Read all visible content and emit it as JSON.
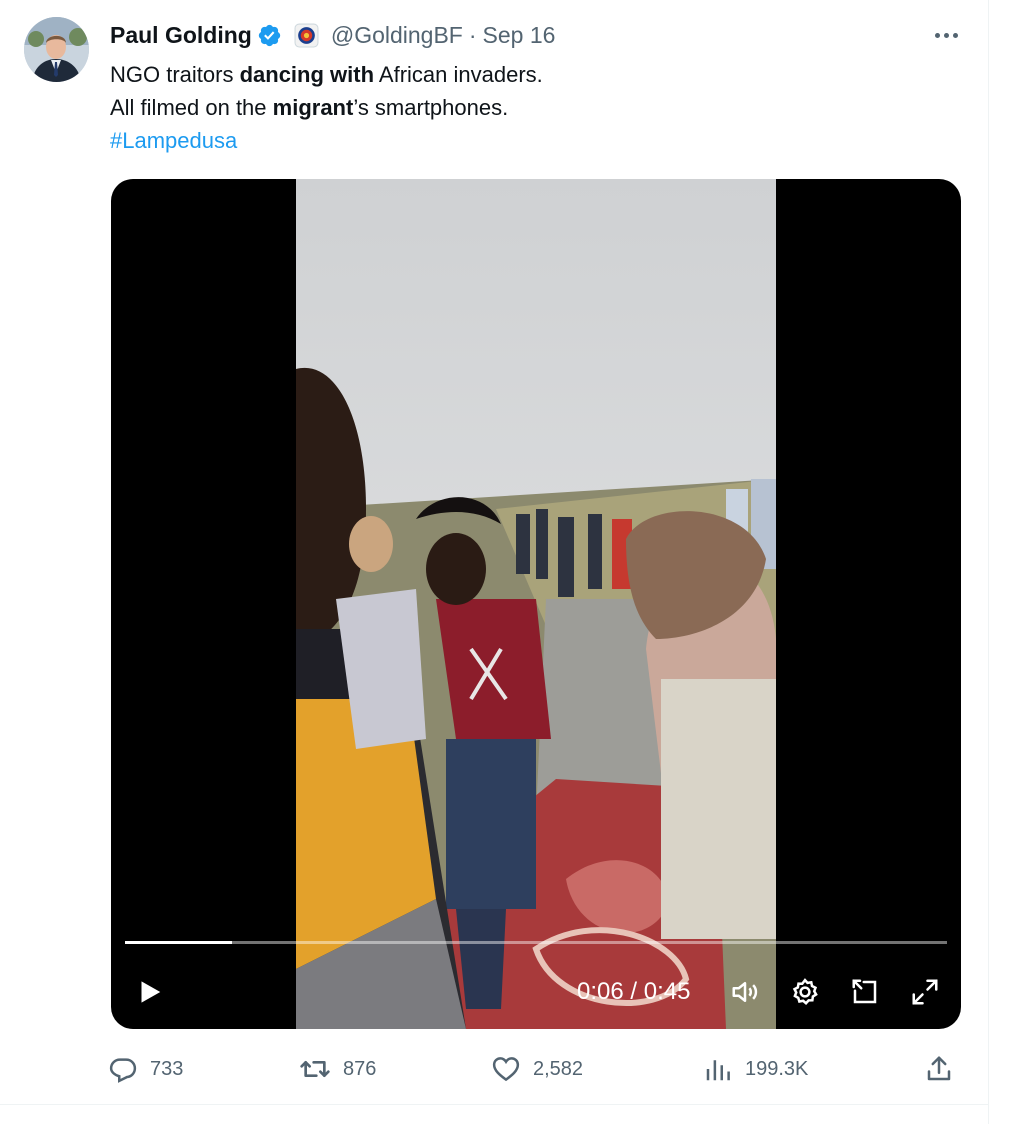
{
  "tweet": {
    "author_name": "Paul Golding",
    "handle": "@GoldingBF",
    "separator": "·",
    "date": "Sep 16",
    "line1_part1": "NGO traitors ",
    "line1_bold": "dancing with",
    "line1_part2": " African invaders.",
    "line2_part1": "All filmed on the ",
    "line2_bold": "migrant",
    "line2_part2": "’s smartphones.",
    "hashtag": "#Lampedusa"
  },
  "video": {
    "current_time": "0:06",
    "time_separator": " / ",
    "duration": "0:45",
    "progress_fraction": 0.13
  },
  "actions": {
    "replies": "733",
    "reposts": "876",
    "likes": "2,582",
    "views": "199.3K"
  },
  "icons": {
    "verified": "verified-badge-icon",
    "affiliate": "affiliate-flag-icon",
    "more": "more-options-icon",
    "play": "play-icon",
    "volume": "volume-icon",
    "settings": "gear-icon",
    "pip": "picture-in-picture-icon",
    "fullscreen": "fullscreen-icon",
    "reply": "reply-icon",
    "repost": "repost-icon",
    "like": "heart-icon",
    "views": "views-chart-icon",
    "share": "share-icon"
  },
  "colors": {
    "text": "#0f1419",
    "secondary": "#536471",
    "link": "#1d9bf0",
    "verified": "#1d9bf0"
  }
}
